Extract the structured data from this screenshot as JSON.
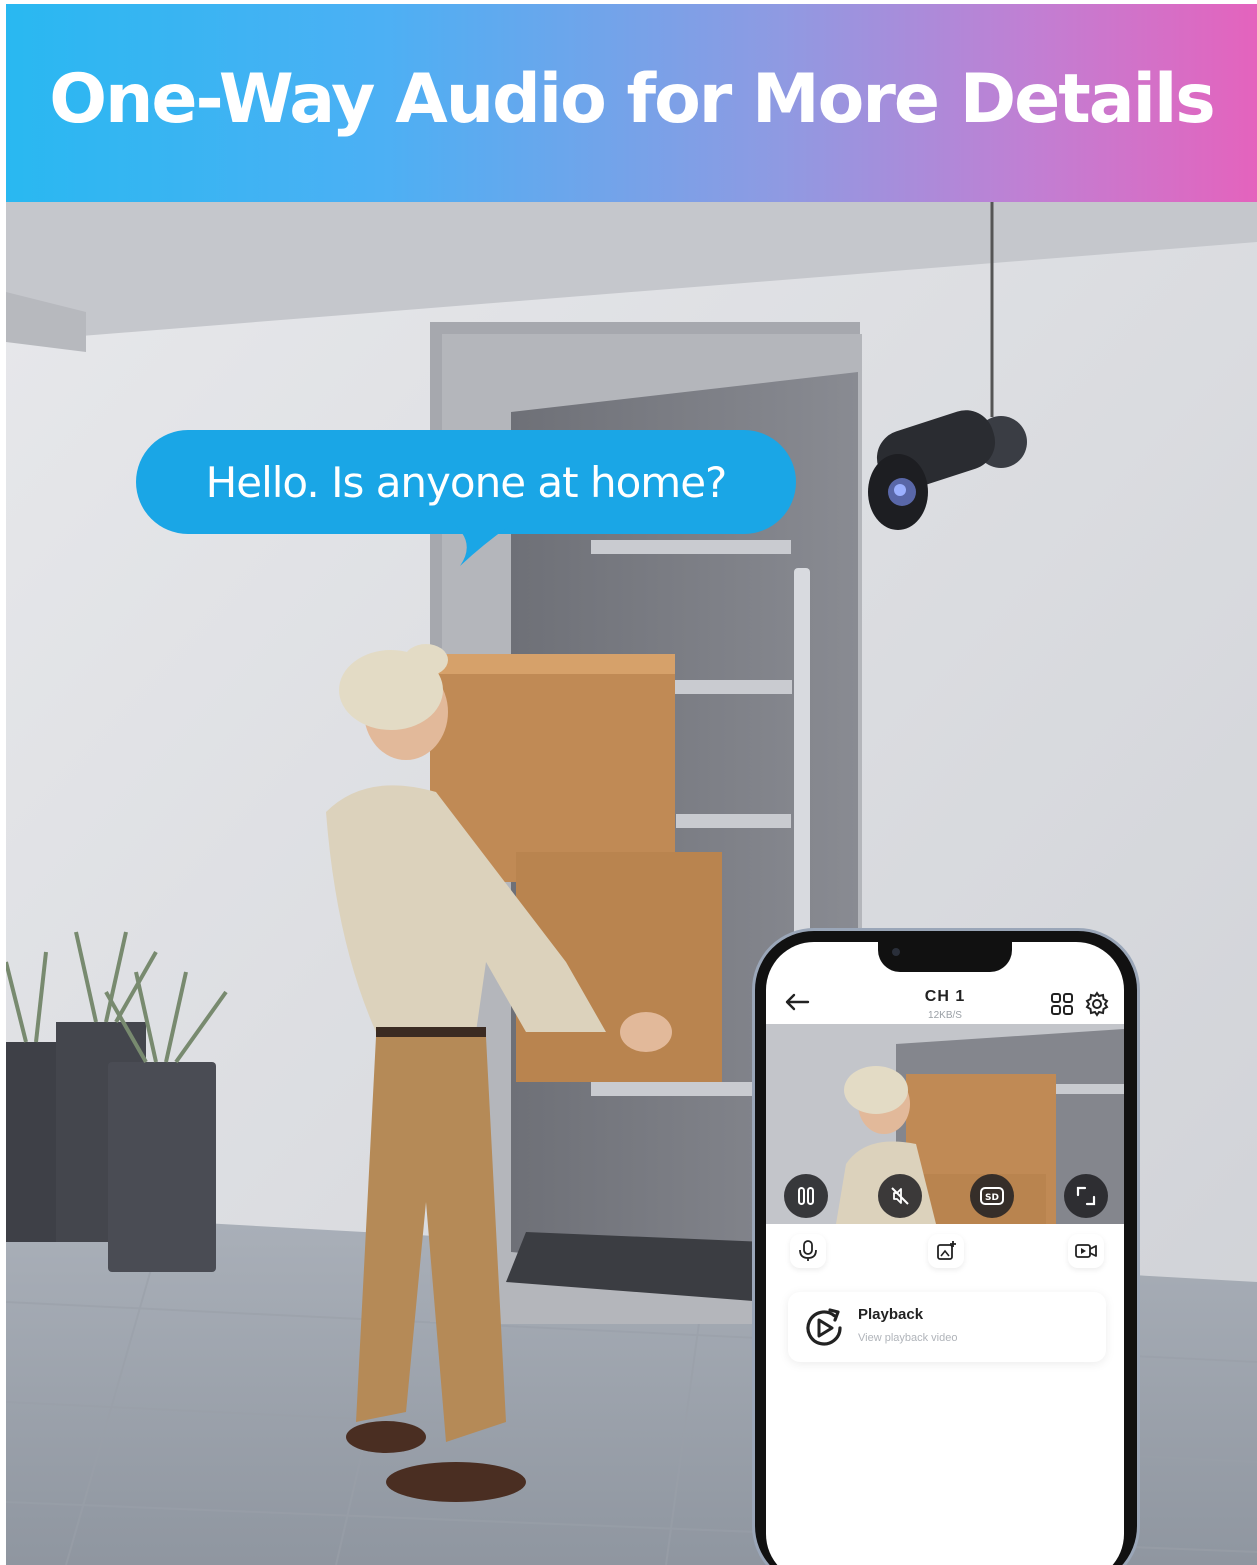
{
  "banner": {
    "title": "One-Way Audio for More Details"
  },
  "speech": {
    "text": "Hello. Is anyone at home?"
  },
  "app": {
    "channel_title": "CH 1",
    "data_rate": "12KB/S",
    "playback": {
      "title": "Playback",
      "subtitle": "View playback video"
    }
  },
  "icons": {
    "back": "arrow-left-icon",
    "grid": "grid-icon",
    "settings": "gear-icon",
    "pause": "pause-icon",
    "mute": "mute-icon",
    "quality": "sd-icon",
    "fullscreen": "fullscreen-icon",
    "mic": "microphone-icon",
    "snapshot": "snapshot-icon",
    "record": "record-video-icon",
    "playback": "playback-icon"
  },
  "colors": {
    "banner_start": "#29b8f1",
    "banner_end": "#e463bd",
    "bubble": "#1aa6e6",
    "wall": "#d8d9dd",
    "door": "#7d7f86"
  }
}
